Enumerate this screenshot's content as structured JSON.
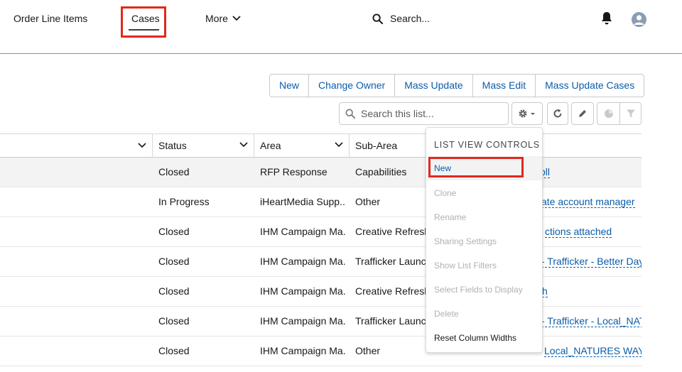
{
  "nav": {
    "items": [
      "Order Line Items",
      "Cases",
      "More"
    ],
    "search_placeholder": "Search..."
  },
  "toolbar": {
    "buttons": [
      "New",
      "Change Owner",
      "Mass Update",
      "Mass Edit",
      "Mass Update Cases"
    ],
    "list_search_placeholder": "Search this list..."
  },
  "table": {
    "columns": [
      "Status",
      "Area",
      "Sub-Area"
    ],
    "rows": [
      {
        "status": "Closed",
        "area": "RFP Response",
        "sub_area": "Capabilities",
        "subject": "oll"
      },
      {
        "status": "In Progress",
        "area": "iHeartMedia Supp...",
        "sub_area": "Other",
        "subject": "ate account manager"
      },
      {
        "status": "Closed",
        "area": "IHM Campaign Ma...",
        "sub_area": "Creative Refresh",
        "subject": "ctions attached"
      },
      {
        "status": "Closed",
        "area": "IHM Campaign Ma...",
        "sub_area": "Trafficker Launch",
        "subject": "- Trafficker - Better Days..."
      },
      {
        "status": "Closed",
        "area": "IHM Campaign Ma...",
        "sub_area": "Creative Refresh",
        "subject": "h"
      },
      {
        "status": "Closed",
        "area": "IHM Campaign Ma...",
        "sub_area": "Trafficker Launch",
        "subject": "- Trafficker - Local_NATU..."
      },
      {
        "status": "Closed",
        "area": "IHM Campaign Ma...",
        "sub_area": "Other",
        "subject": "Local_NATURES WAY R..."
      }
    ]
  },
  "dropdown": {
    "header": "LIST VIEW CONTROLS",
    "items": [
      {
        "label": "New",
        "enabled": true
      },
      {
        "label": "Clone",
        "enabled": false
      },
      {
        "label": "Rename",
        "enabled": false
      },
      {
        "label": "Sharing Settings",
        "enabled": false
      },
      {
        "label": "Show List Filters",
        "enabled": false
      },
      {
        "label": "Select Fields to Display",
        "enabled": false
      },
      {
        "label": "Delete",
        "enabled": false
      },
      {
        "label": "Reset Column Widths",
        "enabled": true
      }
    ]
  },
  "colors": {
    "link": "#0b5cab",
    "highlight": "#e0291d"
  }
}
